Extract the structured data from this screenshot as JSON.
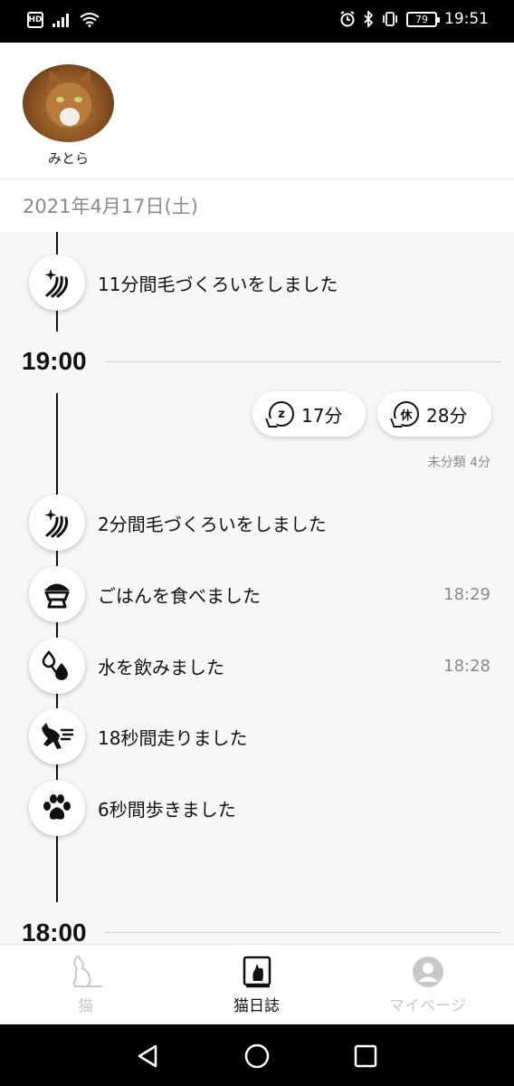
{
  "status_bar": {
    "hd": "HD",
    "battery": "79",
    "time": "19:51"
  },
  "cat": {
    "name": "みとら"
  },
  "date": "2021年4月17日(土)",
  "events_top": [
    {
      "icon": "grooming-icon",
      "text": "11分間毛づくろいをしました",
      "time": ""
    }
  ],
  "hour_1900": "19:00",
  "summary": {
    "sleep": {
      "icon_letter": "z",
      "value": "17分"
    },
    "rest": {
      "icon_letter": "休",
      "value": "28分"
    },
    "unclassified": "未分類 4分"
  },
  "events_1900": [
    {
      "icon": "grooming-icon",
      "text": "2分間毛づくろいをしました",
      "time": ""
    },
    {
      "icon": "food-bowl-icon",
      "text": "ごはんを食べました",
      "time": "18:29"
    },
    {
      "icon": "water-drop-icon",
      "text": "水を飲みました",
      "time": "18:28"
    },
    {
      "icon": "running-cat-icon",
      "text": "18秒間走りました",
      "time": ""
    },
    {
      "icon": "paw-icon",
      "text": "6秒間歩きました",
      "time": ""
    }
  ],
  "hour_1800": "18:00",
  "bottom_nav": [
    {
      "label": "猫",
      "icon": "cat-icon",
      "active": false
    },
    {
      "label": "猫日誌",
      "icon": "diary-icon",
      "active": true
    },
    {
      "label": "マイページ",
      "icon": "user-icon",
      "active": false
    }
  ],
  "colors": {
    "accent": "#111111",
    "muted": "#8a8a8a",
    "inactive": "#c8c8c8",
    "timeline_bg": "#f7f7f7"
  }
}
